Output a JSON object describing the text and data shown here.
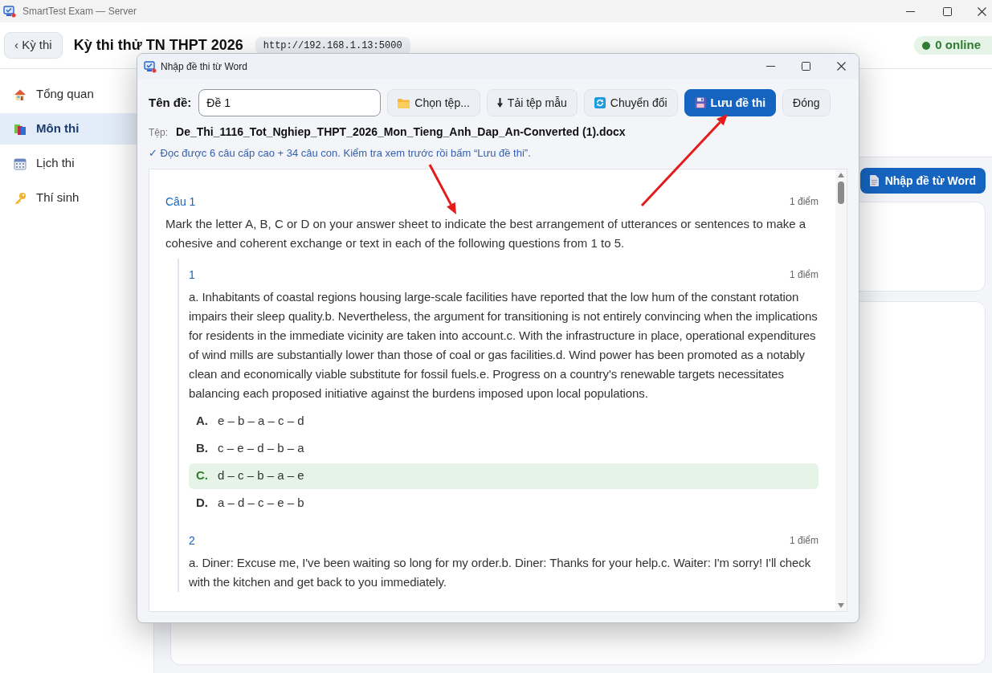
{
  "window": {
    "title": "SmartTest Exam — Server"
  },
  "header": {
    "back_button": "‹ Kỳ thi",
    "title": "Kỳ thi thử TN THPT 2026",
    "server_url": "http://192.168.1.13:5000",
    "online_status": "0 online"
  },
  "sidebar": {
    "items": [
      {
        "label": "Tổng quan",
        "kind": "overview",
        "selected": false
      },
      {
        "label": "Môn thi",
        "kind": "subjects",
        "selected": true
      },
      {
        "label": "Lịch thi",
        "kind": "schedule",
        "selected": false
      },
      {
        "label": "Thí sinh",
        "kind": "candidates",
        "selected": false
      }
    ]
  },
  "main": {
    "import_button": "Nhập đề từ Word"
  },
  "dialog": {
    "title": "Nhập đề thi từ Word",
    "name_label": "Tên đề:",
    "name_value": "Đề 1",
    "buttons": [
      {
        "label": "Chọn tệp...",
        "kind": "choose_file",
        "primary": false
      },
      {
        "label": "Tải tệp mẫu",
        "kind": "download_template",
        "primary": false
      },
      {
        "label": "Chuyển đổi",
        "kind": "convert",
        "primary": false
      },
      {
        "label": "Lưu đề thi",
        "kind": "save",
        "primary": true
      },
      {
        "label": "Đóng",
        "kind": "close",
        "primary": false
      }
    ],
    "file_label": "Tệp:",
    "file_name": "De_Thi_1116_Tot_Nghiep_THPT_2026_Mon_Tieng_Anh_Dap_An-Converted (1).docx",
    "status_message": "✓ Đọc được 6 câu cấp cao + 34 câu con. Kiểm tra xem trước rồi bấm “Lưu đề thi”.",
    "preview": {
      "questions": [
        {
          "label": "Câu 1",
          "points": "1 điểm",
          "text": "Mark the letter A, B, C or D on your answer sheet to indicate the best arrangement of utterances or sentences to make a cohesive and coherent exchange or text in each of the following questions from 1 to 5.",
          "children": [
            {
              "label": "1",
              "points": "1 điểm",
              "text": "a. Inhabitants of coastal regions housing large-scale facilities have reported that the low hum of the constant rotation impairs their sleep quality.b. Nevertheless, the argument for transitioning is not entirely convincing when the implications for residents in the immediate vicinity are taken into account.c. With the infrastructure in place, operational expenditures of wind mills are substantially lower than those of coal or gas facilities.d. Wind power has been promoted as a notably clean and economically viable substitute for fossil fuels.e. Progress on a country's renewable targets necessitates balancing each proposed initiative against the burdens imposed upon local populations.",
              "options": [
                {
                  "letter": "A.",
                  "text": "e – b – a – c – d",
                  "correct": false
                },
                {
                  "letter": "B.",
                  "text": "c – e – d – b – a",
                  "correct": false
                },
                {
                  "letter": "C.",
                  "text": "d – c – b – a – e",
                  "correct": true
                },
                {
                  "letter": "D.",
                  "text": "a – d – c – e – b",
                  "correct": false
                }
              ]
            },
            {
              "label": "2",
              "points": "1 điểm",
              "text": "a. Diner: Excuse me, I've been waiting so long for my order.b. Diner: Thanks for your help.c. Waiter: I'm sorry! I'll check with the kitchen and get back to you immediately."
            }
          ]
        }
      ]
    }
  }
}
